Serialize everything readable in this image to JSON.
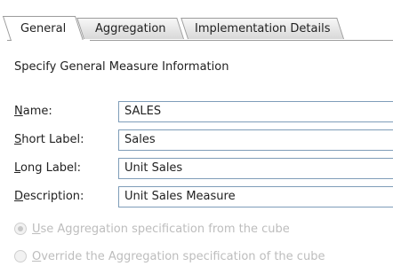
{
  "tabs": [
    {
      "label": "General",
      "active": true
    },
    {
      "label": "Aggregation",
      "active": false
    },
    {
      "label": "Implementation Details",
      "active": false
    }
  ],
  "heading": "Specify General Measure Information",
  "fields": {
    "name": {
      "label_mnemonic": "N",
      "label_rest": "ame:",
      "value": "SALES"
    },
    "short_label": {
      "label_mnemonic": "S",
      "label_rest": "hort Label:",
      "value": "Sales"
    },
    "long_label": {
      "label_mnemonic": "L",
      "label_rest": "ong Label:",
      "value": "Unit Sales"
    },
    "description": {
      "label_mnemonic": "D",
      "label_rest": "escription:",
      "value": "Unit Sales Measure"
    }
  },
  "radios": [
    {
      "mnemonic": "U",
      "rest": "se Aggregation specification from the cube",
      "checked": true,
      "enabled": false
    },
    {
      "mnemonic": "O",
      "rest": "verride the Aggregation specification of the cube",
      "checked": false,
      "enabled": false
    }
  ],
  "colors": {
    "input_border": "#7f9db9",
    "disabled_text": "#bdbdbd",
    "tab_border": "#9c9c9c"
  }
}
